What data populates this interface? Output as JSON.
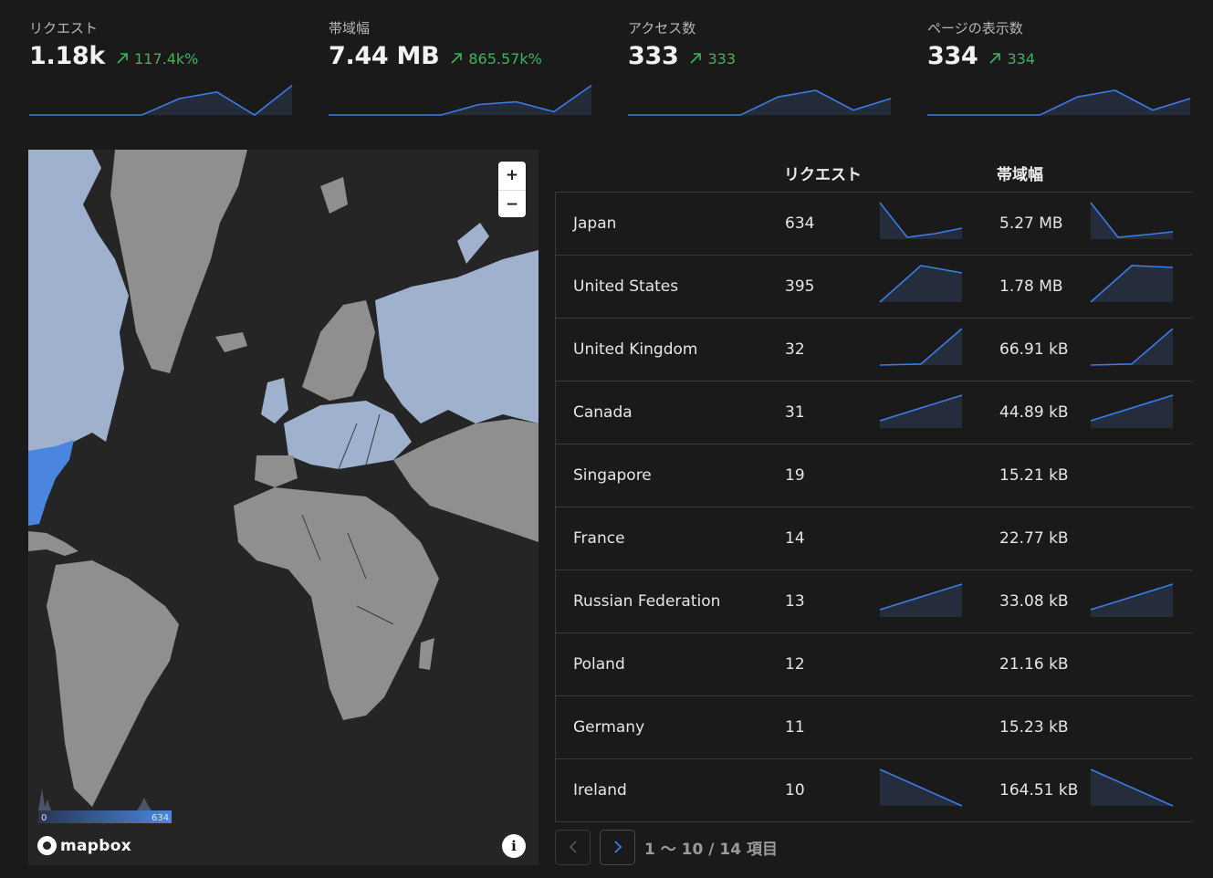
{
  "stats": [
    {
      "label": "リクエスト",
      "value": "1.18k",
      "delta": "117.4k%",
      "spark": [
        0,
        0,
        0,
        0,
        0.5,
        0.7,
        0,
        0.9
      ]
    },
    {
      "label": "帯域幅",
      "value": "7.44 MB",
      "delta": "865.57k%",
      "spark": [
        0,
        0,
        0,
        0,
        0.32,
        0.4,
        0.1,
        0.9
      ]
    },
    {
      "label": "アクセス数",
      "value": "333",
      "delta": "333",
      "spark": [
        0,
        0,
        0,
        0,
        0.55,
        0.75,
        0.15,
        0.5
      ]
    },
    {
      "label": "ページの表示数",
      "value": "334",
      "delta": "334",
      "spark": [
        0,
        0,
        0,
        0,
        0.55,
        0.75,
        0.15,
        0.5
      ]
    }
  ],
  "colors": {
    "accent": "#3b7be8",
    "positive": "#3fb25b",
    "background": "#1a1a1b",
    "map_high": "#4a86e0",
    "map_mid": "#9fb1cc",
    "map_none": "#8f8f8f",
    "map_sea": "#252526"
  },
  "map": {
    "zoom_in_label": "+",
    "zoom_out_label": "−",
    "legend_min": "0",
    "legend_max": "634",
    "attribution_logo": "mapbox",
    "info_icon": "i"
  },
  "table": {
    "headers": {
      "country": "",
      "requests": "リクエスト",
      "bandwidth": "帯域幅"
    },
    "rows": [
      {
        "country": "Japan",
        "requests": "634",
        "bandwidth": "5.27 MB",
        "req_spark": [
          1,
          0.05,
          0.15,
          0.3
        ],
        "bw_spark": [
          1,
          0.05,
          0.12,
          0.2
        ]
      },
      {
        "country": "United States",
        "requests": "395",
        "bandwidth": "1.78 MB",
        "req_spark": [
          0,
          1,
          0.8
        ],
        "bw_spark": [
          0,
          1,
          0.95
        ]
      },
      {
        "country": "United Kingdom",
        "requests": "32",
        "bandwidth": "66.91 kB",
        "req_spark": [
          0,
          0.03,
          1
        ],
        "bw_spark": [
          0,
          0.03,
          1
        ]
      },
      {
        "country": "Canada",
        "requests": "31",
        "bandwidth": "44.89 kB",
        "req_spark": [
          0.2,
          0.9
        ],
        "bw_spark": [
          0.2,
          0.9
        ]
      },
      {
        "country": "Singapore",
        "requests": "19",
        "bandwidth": "15.21 kB",
        "req_spark": null,
        "bw_spark": null
      },
      {
        "country": "France",
        "requests": "14",
        "bandwidth": "22.77 kB",
        "req_spark": null,
        "bw_spark": null
      },
      {
        "country": "Russian Federation",
        "requests": "13",
        "bandwidth": "33.08 kB",
        "req_spark": [
          0.2,
          0.9
        ],
        "bw_spark": [
          0.2,
          0.9
        ]
      },
      {
        "country": "Poland",
        "requests": "12",
        "bandwidth": "21.16 kB",
        "req_spark": null,
        "bw_spark": null
      },
      {
        "country": "Germany",
        "requests": "11",
        "bandwidth": "15.23 kB",
        "req_spark": null,
        "bw_spark": null
      },
      {
        "country": "Ireland",
        "requests": "10",
        "bandwidth": "164.51 kB",
        "req_spark": [
          1,
          0
        ],
        "bw_spark": [
          1,
          0
        ]
      }
    ]
  },
  "pagination": {
    "info": "1 〜 10 / 14 項目",
    "prev_icon": "chevron-left-icon",
    "next_icon": "chevron-right-icon"
  }
}
